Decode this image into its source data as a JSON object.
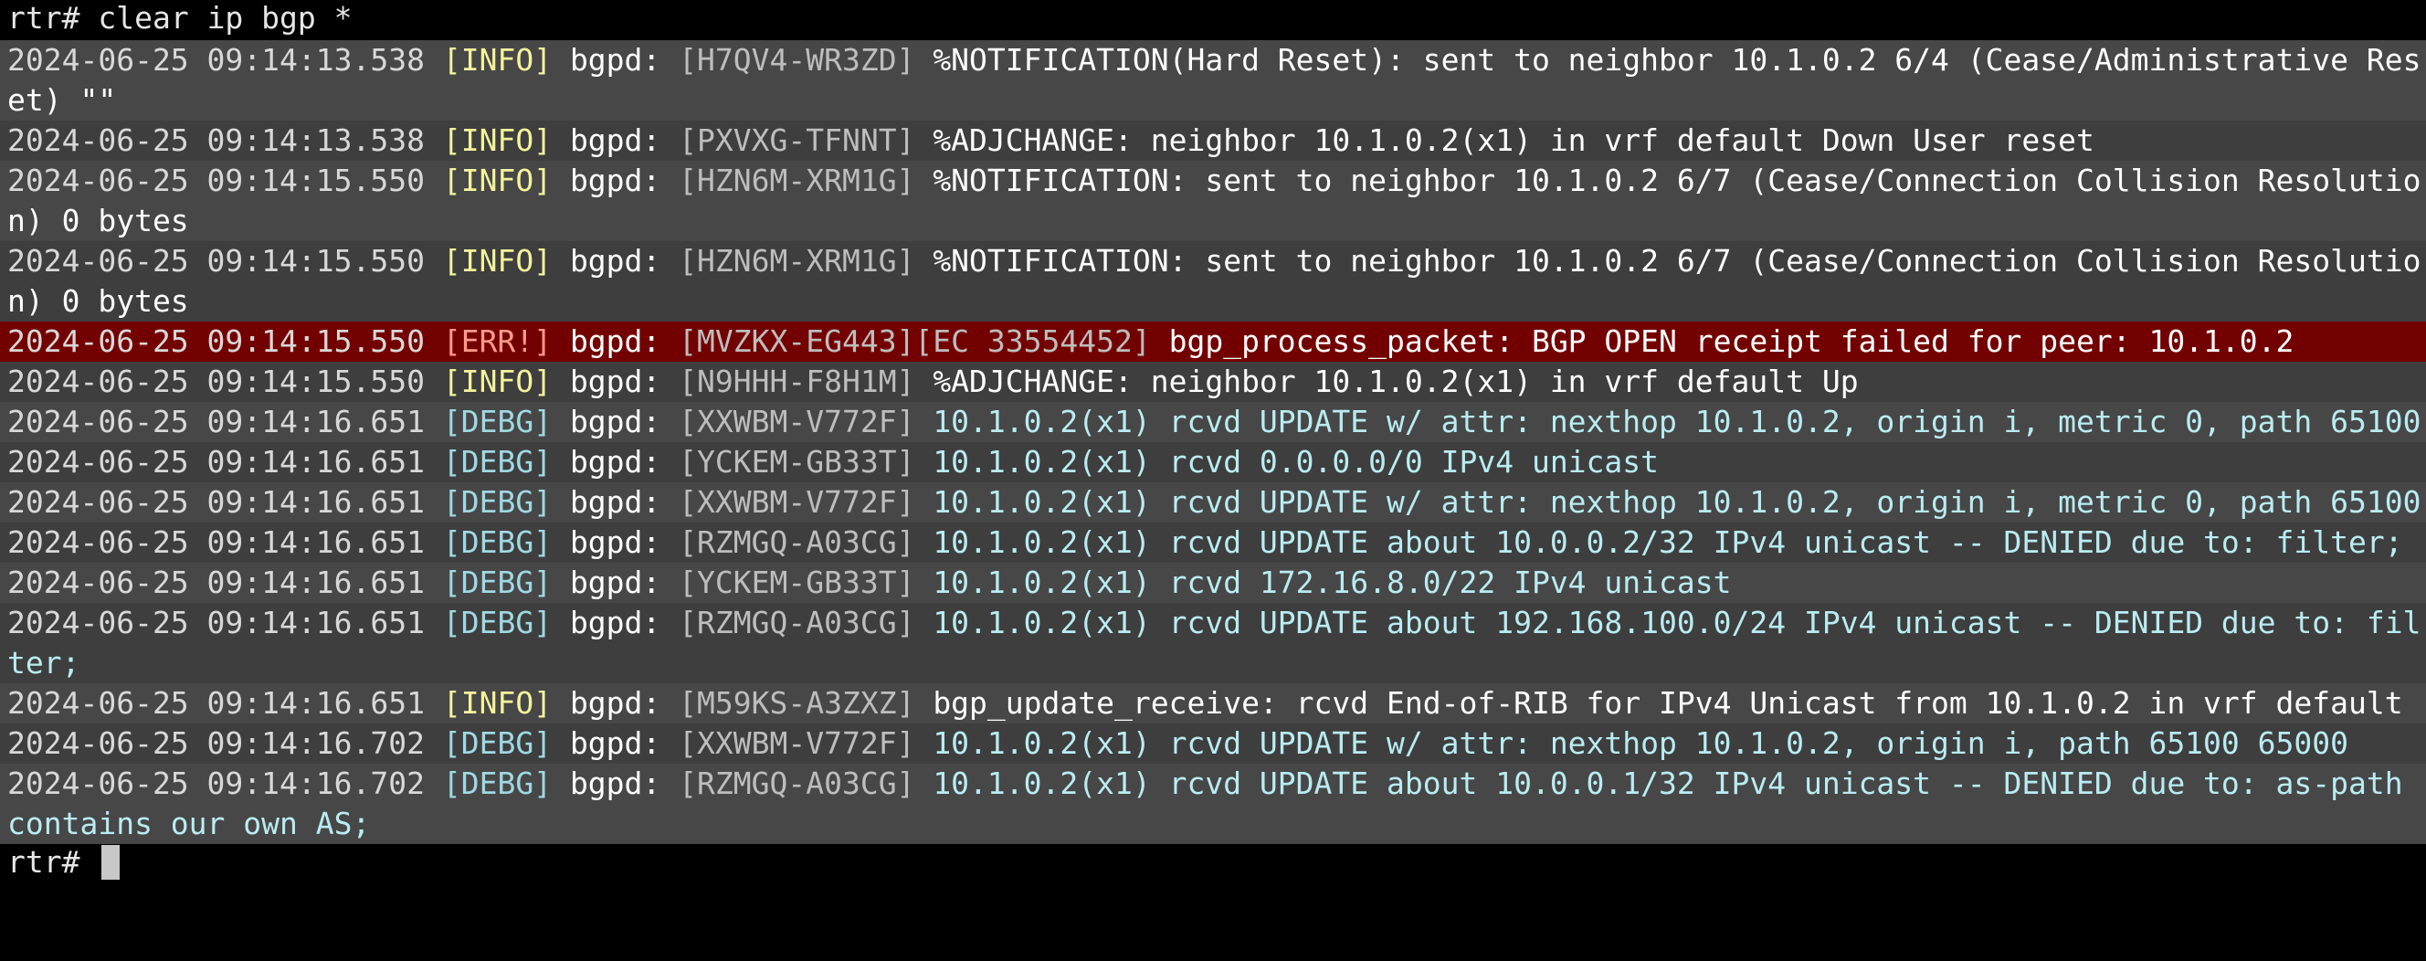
{
  "terminal": {
    "command_prompt": "rtr#",
    "command": "clear ip bgp *",
    "final_prompt": "rtr#"
  },
  "log": [
    {
      "ts": "2024-06-25 09:14:13.538",
      "level": "[INFO]",
      "daemon": "bgpd:",
      "tag": "[H7QV4-WR3ZD]",
      "msg": "%NOTIFICATION(Hard Reset): sent to neighbor 10.1.0.2 6/4 (Cease/Administrative Reset) \"\"",
      "kind": "info"
    },
    {
      "ts": "2024-06-25 09:14:13.538",
      "level": "[INFO]",
      "daemon": "bgpd:",
      "tag": "[PXVXG-TFNNT]",
      "msg": "%ADJCHANGE: neighbor 10.1.0.2(x1) in vrf default Down User reset",
      "kind": "info"
    },
    {
      "ts": "2024-06-25 09:14:15.550",
      "level": "[INFO]",
      "daemon": "bgpd:",
      "tag": "[HZN6M-XRM1G]",
      "msg": "%NOTIFICATION: sent to neighbor 10.1.0.2 6/7 (Cease/Connection Collision Resolution) 0 bytes",
      "kind": "info"
    },
    {
      "ts": "2024-06-25 09:14:15.550",
      "level": "[INFO]",
      "daemon": "bgpd:",
      "tag": "[HZN6M-XRM1G]",
      "msg": "%NOTIFICATION: sent to neighbor 10.1.0.2 6/7 (Cease/Connection Collision Resolution) 0 bytes",
      "kind": "info"
    },
    {
      "ts": "2024-06-25 09:14:15.550",
      "level": "[ERR!]",
      "daemon": "bgpd:",
      "tag": "[MVZKX-EG443][EC 33554452]",
      "msg": "bgp_process_packet: BGP OPEN receipt failed for peer: 10.1.0.2",
      "kind": "err"
    },
    {
      "ts": "2024-06-25 09:14:15.550",
      "level": "[INFO]",
      "daemon": "bgpd:",
      "tag": "[N9HHH-F8H1M]",
      "msg": "%ADJCHANGE: neighbor 10.1.0.2(x1) in vrf default Up",
      "kind": "info"
    },
    {
      "ts": "2024-06-25 09:14:16.651",
      "level": "[DEBG]",
      "daemon": "bgpd:",
      "tag": "[XXWBM-V772F]",
      "msg": "10.1.0.2(x1) rcvd UPDATE w/ attr: nexthop 10.1.0.2, origin i, metric 0, path 65100",
      "kind": "debg"
    },
    {
      "ts": "2024-06-25 09:14:16.651",
      "level": "[DEBG]",
      "daemon": "bgpd:",
      "tag": "[YCKEM-GB33T]",
      "msg": "10.1.0.2(x1) rcvd 0.0.0.0/0 IPv4 unicast",
      "kind": "debg"
    },
    {
      "ts": "2024-06-25 09:14:16.651",
      "level": "[DEBG]",
      "daemon": "bgpd:",
      "tag": "[XXWBM-V772F]",
      "msg": "10.1.0.2(x1) rcvd UPDATE w/ attr: nexthop 10.1.0.2, origin i, metric 0, path 65100",
      "kind": "debg"
    },
    {
      "ts": "2024-06-25 09:14:16.651",
      "level": "[DEBG]",
      "daemon": "bgpd:",
      "tag": "[RZMGQ-A03CG]",
      "msg": "10.1.0.2(x1) rcvd UPDATE about 10.0.0.2/32 IPv4 unicast -- DENIED due to: filter;",
      "kind": "debg"
    },
    {
      "ts": "2024-06-25 09:14:16.651",
      "level": "[DEBG]",
      "daemon": "bgpd:",
      "tag": "[YCKEM-GB33T]",
      "msg": "10.1.0.2(x1) rcvd 172.16.8.0/22 IPv4 unicast",
      "kind": "debg"
    },
    {
      "ts": "2024-06-25 09:14:16.651",
      "level": "[DEBG]",
      "daemon": "bgpd:",
      "tag": "[RZMGQ-A03CG]",
      "msg": "10.1.0.2(x1) rcvd UPDATE about 192.168.100.0/24 IPv4 unicast -- DENIED due to: filter;",
      "kind": "debg"
    },
    {
      "ts": "2024-06-25 09:14:16.651",
      "level": "[INFO]",
      "daemon": "bgpd:",
      "tag": "[M59KS-A3ZXZ]",
      "msg": "bgp_update_receive: rcvd End-of-RIB for IPv4 Unicast from 10.1.0.2 in vrf default",
      "kind": "info"
    },
    {
      "ts": "2024-06-25 09:14:16.702",
      "level": "[DEBG]",
      "daemon": "bgpd:",
      "tag": "[XXWBM-V772F]",
      "msg": "10.1.0.2(x1) rcvd UPDATE w/ attr: nexthop 10.1.0.2, origin i, path 65100 65000",
      "kind": "debg"
    },
    {
      "ts": "2024-06-25 09:14:16.702",
      "level": "[DEBG]",
      "daemon": "bgpd:",
      "tag": "[RZMGQ-A03CG]",
      "msg": "10.1.0.2(x1) rcvd UPDATE about 10.0.0.1/32 IPv4 unicast -- DENIED due to: as-path contains our own AS;",
      "kind": "debg"
    }
  ],
  "colors": {
    "background": "#000000",
    "row": "#474747",
    "row_alt": "#3e3e3e",
    "error_row": "#730000"
  }
}
